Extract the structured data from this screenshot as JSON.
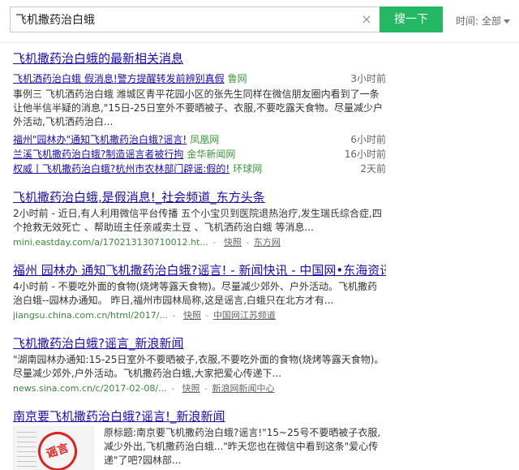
{
  "search": {
    "query": "飞机撒药治白蛾",
    "button_label": "搜一下",
    "clear_icon": "×",
    "time_label": "时间:",
    "time_value": "全部"
  },
  "results": {
    "r1": {
      "title": "飞机撒药治白蛾的最新相关消息",
      "news": [
        {
          "title": "飞机洒药治白蛾 假消息!警方提醒转发前辨别真假",
          "source": "鲁网",
          "time": "3小时前"
        },
        {
          "title": "福州\"园林办\"通知飞机撒药治白蛾?谣言!",
          "source": "凤凰网",
          "time": "6小时前"
        },
        {
          "title": "兰溪飞机撒药治白蛾?制造谣言者被行拘",
          "source": "金华新闻网",
          "time": "16小时前"
        },
        {
          "title": "权威丨飞机撒药治白蛾?杭州市农林部门辟谣:假的!",
          "source": "环球网",
          "time": "2天前"
        }
      ],
      "snippet": "事例三 飞机洒药治白蛾 潍城区青平花园小区的张先生同样在微信朋友圈内看到了一条让他半信半疑的消息,\"15日-25日室外不要晒被子、衣服,不要吃露天食物。尽量减少户外活动,飞机洒药治白..."
    },
    "r2": {
      "title": "飞机撒药治白蛾,是假消息!_社会频道_东方头条",
      "snippet": "2小时前 - 近日,有人利用微信平台传播 五个小宝贝到医院退热治疗,发生瑞氏综合症,四个抢救无效死亡 、帮助班主任亲戚卖土豆 、飞机洒药治白蛾 等消息...",
      "url": "mini.eastday.com/a/170213130710012.ht...",
      "cache": "快照",
      "source": "东方网"
    },
    "r3": {
      "title": "福州 园林办 通知飞机撒药治白蛾?谣言! - 新闻快讯 - 中国网•东海资讯",
      "snippet": "4小时前 - 不要吃外面的食物(烧烤等露天食物)。尽量减少郊外、户外活动。飞机撒药治白蛾--园林办通知。 昨日,福州市园林局称,这是谣言,白蛾只在北方才有...",
      "url": "jiangsu.china.com.cn/html/2017/...",
      "cache": "快照",
      "source": "中国网江苏频道"
    },
    "r4": {
      "title": "飞机撒药治白蛾?谣言_新浪新闻",
      "snippet": "\"湖南园林办通知:15-25日室外不要晒被子,衣服,不要吃外面的食物(烧烤等露天食物)。尽量减少郊外,户外活动。飞机撒药治白蛾,大家把爱心传递下...",
      "url": "news.sina.com.cn/c/2017-02-08/...",
      "cache": "快照",
      "source": "新浪网新闻中心"
    },
    "r5": {
      "title": "南京要飞机撒药治白蛾?谣言!_新浪新闻",
      "snippet": "原标题:南京要飞机撒药治白蛾?谣言!\"15~25号不要晒被子衣服,减少外出,飞机撒药治白蛾...\"昨天您也在微信中看到这条\"爱心传递\"了吧?园林部...",
      "stamp_text": "谣言"
    }
  }
}
